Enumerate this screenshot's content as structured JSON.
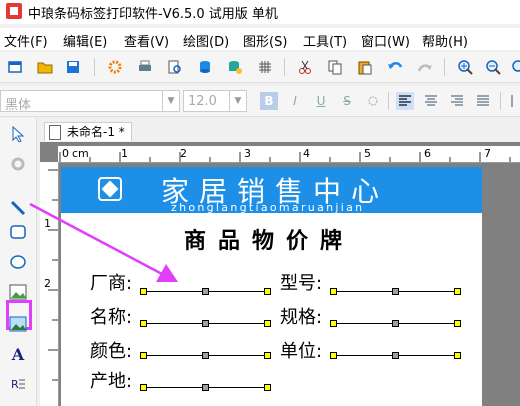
{
  "window": {
    "title": "中琅条码标签打印软件-V6.5.0 试用版 单机"
  },
  "menu": [
    "文件(F)",
    "编辑(E)",
    "查看(V)",
    "绘图(D)",
    "图形(S)",
    "工具(T)",
    "窗口(W)",
    "帮助(H)"
  ],
  "format": {
    "font": "黑体",
    "size": "12.0",
    "bold": "B",
    "italic": "I",
    "underline": "U",
    "strike": "S"
  },
  "tab": {
    "name": "未命名-1 *"
  },
  "ruler": {
    "unit": "cm",
    "h_marks": [
      "0",
      "1",
      "2",
      "3",
      "4",
      "5",
      "6",
      "7"
    ],
    "v_marks": [
      "1",
      "2"
    ]
  },
  "label": {
    "banner_title": "家居销售中心",
    "banner_subtitle": "zhonglangtiaomaruanjian",
    "heading": "商品物价牌",
    "fields_left": [
      "厂商:",
      "名称:",
      "颜色:",
      "产地:"
    ],
    "fields_right": [
      "型号:",
      "规格:",
      "单位:"
    ]
  },
  "colors": {
    "banner": "#1e8fe6",
    "highlight": "#e040fb",
    "handle": "#ffff00"
  }
}
